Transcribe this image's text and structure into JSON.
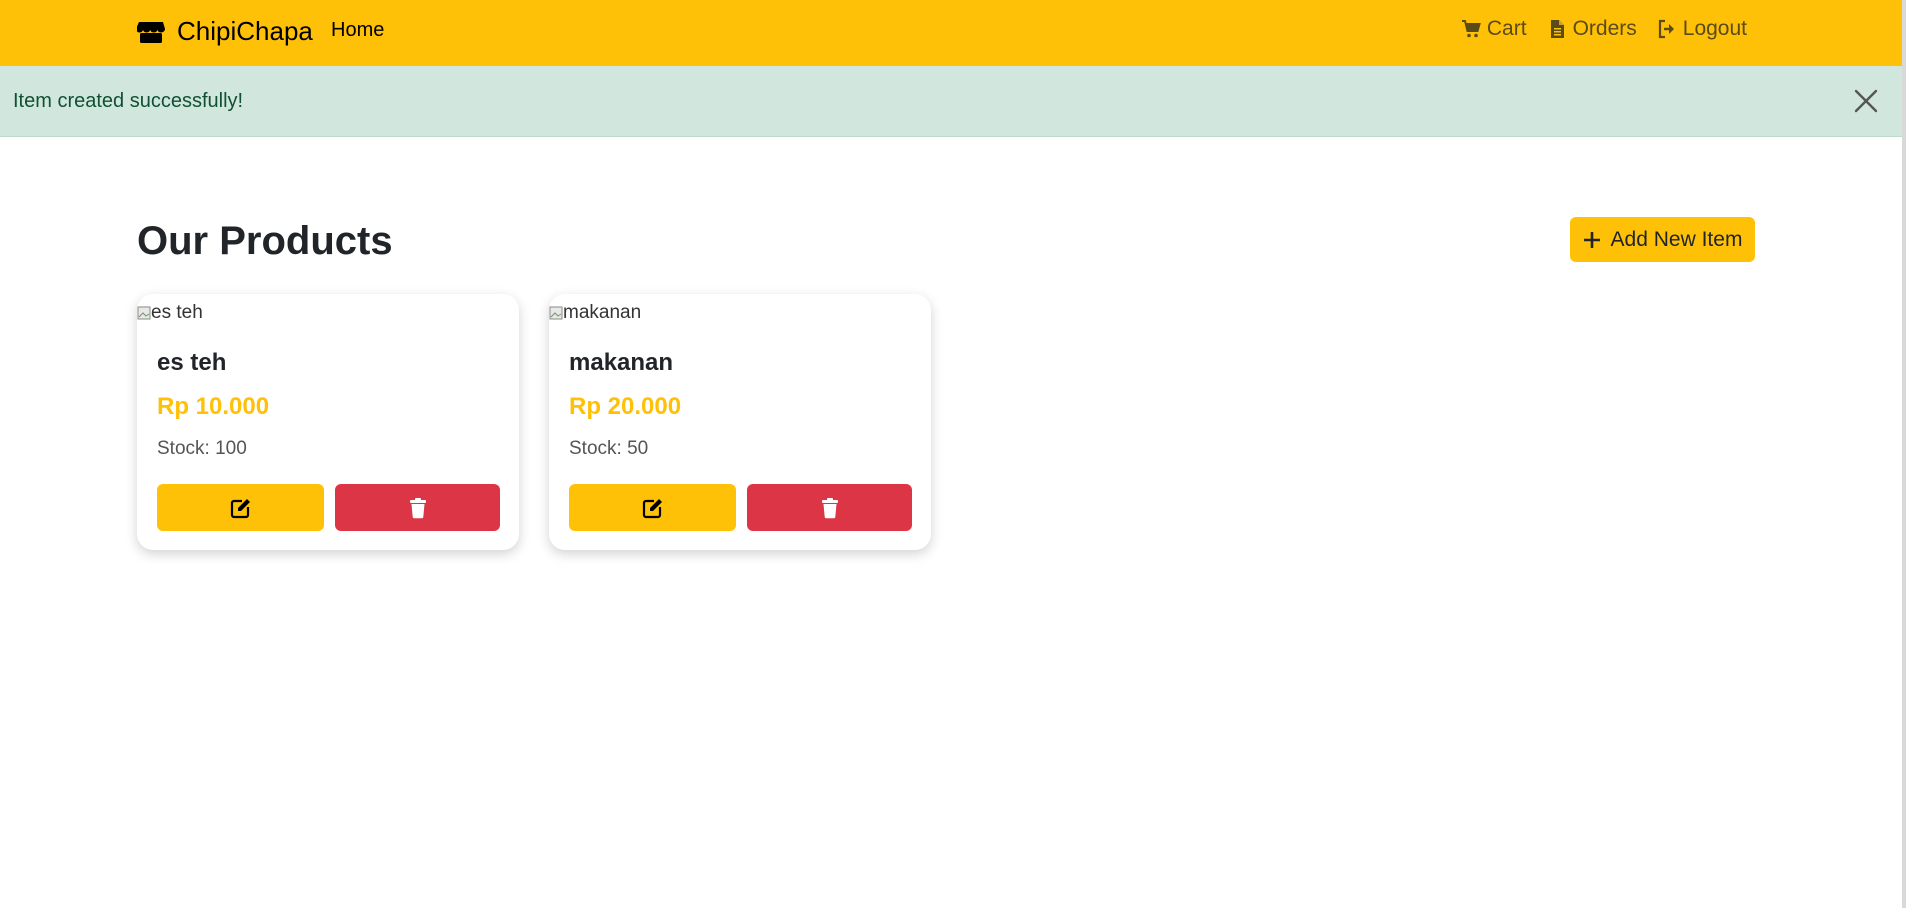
{
  "navbar": {
    "brand": "ChipiChapa",
    "brand_icon": "store-icon",
    "home_label": "Home",
    "links": [
      {
        "label": "Cart",
        "icon": "cart-icon"
      },
      {
        "label": "Orders",
        "icon": "file-icon"
      },
      {
        "label": "Logout",
        "icon": "logout-icon"
      }
    ],
    "color": "#ffc107"
  },
  "alert": {
    "message": "Item created successfully!",
    "close_icon": "close-icon",
    "background": "#d1e7dd"
  },
  "main": {
    "title": "Our Products",
    "add_button_label": "Add New Item",
    "add_button_icon": "plus-icon"
  },
  "products": [
    {
      "image_alt": "es teh",
      "name": "es teh",
      "price": "Rp 10.000",
      "stock": "Stock: 100"
    },
    {
      "image_alt": "makanan",
      "name": "makanan",
      "price": "Rp 20.000",
      "stock": "Stock: 50"
    }
  ],
  "colors": {
    "accent": "#ffc107",
    "danger": "#dc3545",
    "success_bg": "#d1e7dd"
  }
}
